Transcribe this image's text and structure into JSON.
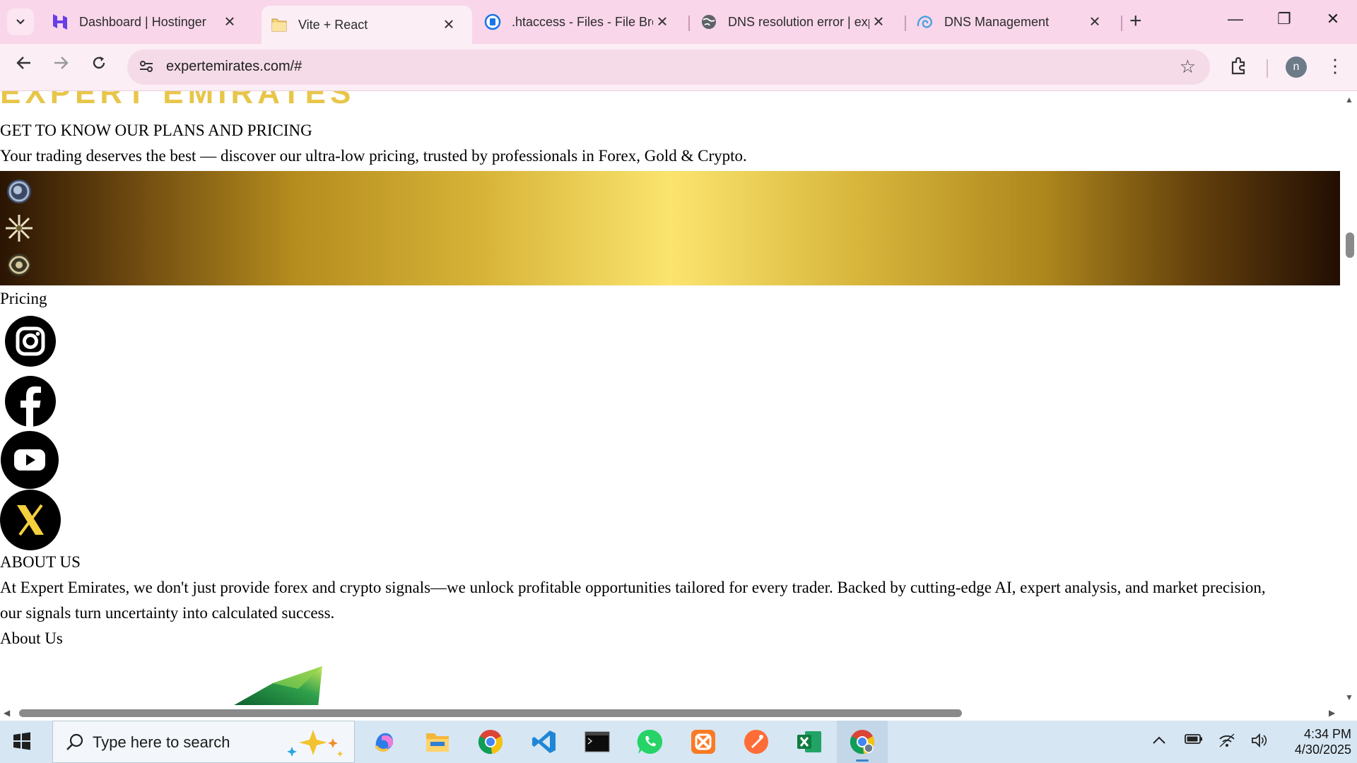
{
  "browser": {
    "tabs": [
      {
        "title": "Dashboard | Hostinger",
        "icon": "hostinger-icon",
        "active": false
      },
      {
        "title": "Vite + React",
        "icon": "folder-icon",
        "active": true
      },
      {
        "title": ".htaccess - Files - File Bro",
        "icon": "file-browser-icon",
        "active": false
      },
      {
        "title": "DNS resolution error | exp",
        "icon": "globe-icon",
        "active": false
      },
      {
        "title": "DNS Management",
        "icon": "dns-icon",
        "active": false
      }
    ],
    "url": "expertemirates.com/#",
    "profile_initial": "n",
    "accent": "#f9d6ea"
  },
  "page": {
    "cut_heading": "EXPERT EMIRATES",
    "plans_heading": "GET TO KNOW OUR PLANS AND PRICING",
    "plans_subtext": "Your trading deserves the best — discover our ultra-low pricing, trusted by professionals in Forex, Gold & Crypto.",
    "pricing_label": "Pricing",
    "social": [
      "instagram-icon",
      "facebook-icon",
      "youtube-icon",
      "x-icon"
    ],
    "about_heading": "ABOUT US",
    "about_line1": "At Expert Emirates, we don't just provide forex and crypto signals—we unlock profitable opportunities tailored for every trader. Backed by cutting-edge AI, expert analysis, and market precision,",
    "about_line2": "our signals turn uncertainty into calculated success.",
    "about_label": "About Us",
    "gold": "#fbe46e"
  },
  "taskbar": {
    "search_placeholder": "Type here to search",
    "time": "4:34 PM",
    "date": "4/30/2025",
    "apps": [
      "copilot-icon",
      "file-explorer-icon",
      "chrome-icon",
      "vscode-icon",
      "terminal-icon",
      "whatsapp-icon",
      "xampp-icon",
      "postman-icon",
      "excel-icon",
      "chrome-profile-icon"
    ]
  }
}
